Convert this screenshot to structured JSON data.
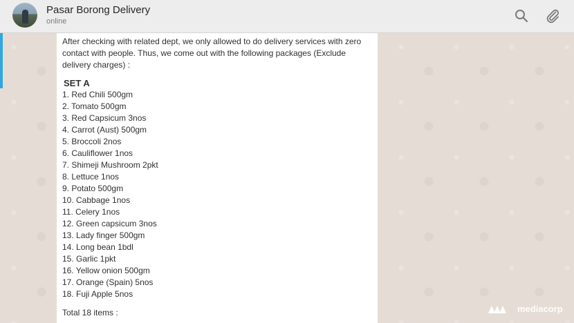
{
  "header": {
    "title": "Pasar Borong Delivery",
    "status": "online",
    "icons": [
      "search-icon",
      "attach-icon"
    ]
  },
  "message": {
    "intro": "After checking with related dept, we only allowed to do delivery services with zero contact with people. Thus, we come out with the following packages (Exclude delivery charges) :",
    "set_title": "SET A",
    "items": [
      "1. Red Chili 500gm",
      "2. Tomato 500gm",
      "3. Red Capsicum 3nos",
      "4. Carrot (Aust) 500gm",
      "5. Broccoli 2nos",
      "6. Cauliflower 1nos",
      "7. Shimeji Mushroom 2pkt",
      "8. Lettuce 1nos",
      "9. Potato 500gm",
      "10. Cabbage 1nos",
      "11. Celery 1nos",
      "12. Green capsicum 3nos",
      "13. Lady finger 500gm",
      "14. Long bean 1bdl",
      "15. Garlic 1pkt",
      "16. Yellow onion 500gm",
      "17. Orange (Spain) 5nos",
      "18. Fuji Apple 5nos"
    ],
    "total": "Total 18 items :"
  },
  "watermark": "mediacorp",
  "colors": {
    "header_bg": "#ededed",
    "wallpaper": "#e5ddd5",
    "bubble": "#ffffff",
    "accent_strip": "#2fa7e0"
  }
}
